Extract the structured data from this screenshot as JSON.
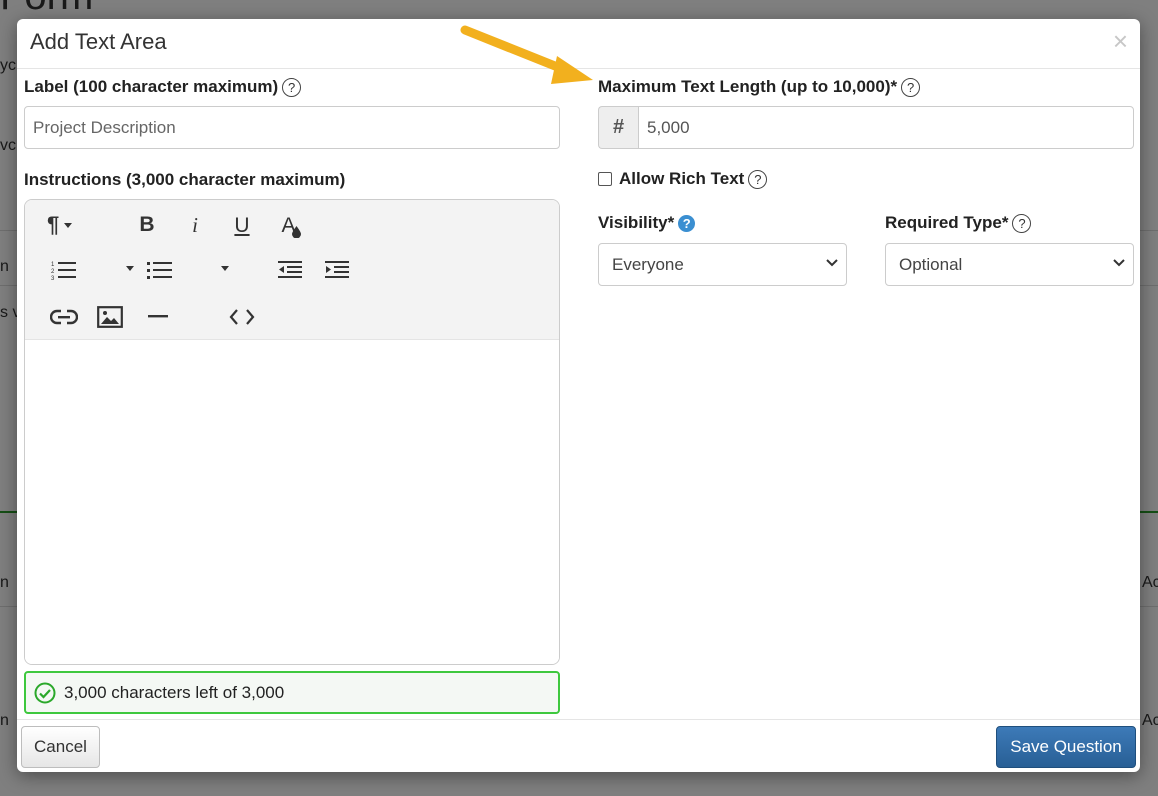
{
  "background": {
    "page_title": "Form",
    "fragments": [
      "yc",
      "vc",
      "n",
      "s v",
      "n",
      "n",
      "Ac",
      "Ac"
    ]
  },
  "modal": {
    "title": "Add Text Area",
    "close_glyph": "×"
  },
  "label_field": {
    "label": "Label (100 character maximum)",
    "placeholder": "Project Description",
    "value": ""
  },
  "instructions": {
    "label": "Instructions (3,000 character maximum)",
    "status_text": "3,000 characters left of 3,000"
  },
  "toolbar": {
    "items": [
      {
        "name": "paragraph-style-icon",
        "glyph": "¶"
      },
      {
        "name": "bold-icon",
        "glyph": "B"
      },
      {
        "name": "italic-icon",
        "glyph": "i"
      },
      {
        "name": "underline-icon",
        "glyph": "U"
      },
      {
        "name": "text-color-icon",
        "glyph": "A"
      }
    ]
  },
  "max_length": {
    "label": "Maximum Text Length (up to 10,000)*",
    "addon": "#",
    "value": "5,000"
  },
  "rich_text": {
    "label": "Allow Rich Text",
    "checked": false
  },
  "visibility": {
    "label": "Visibility*",
    "selected": "Everyone"
  },
  "required_type": {
    "label": "Required Type*",
    "selected": "Optional"
  },
  "footer": {
    "cancel_label": "Cancel",
    "save_label": "Save Question"
  },
  "help_glyph": "?",
  "colors": {
    "primary": "#2f6ca6",
    "success": "#3ec83e",
    "info": "#3b8fd1",
    "arrow": "#f2b01e"
  }
}
